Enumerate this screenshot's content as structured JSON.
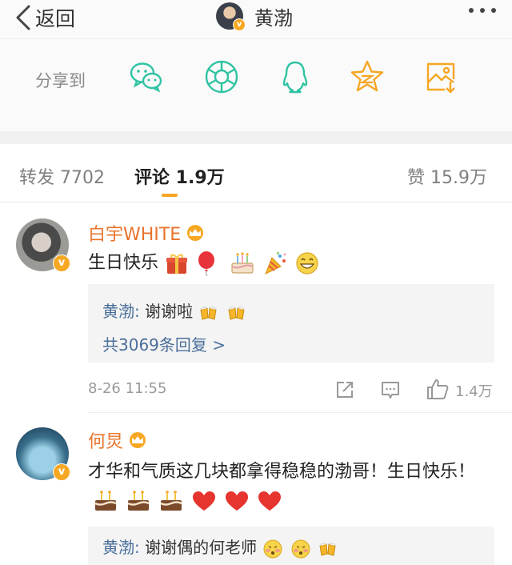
{
  "nav": {
    "back_label": "返回",
    "title": "黄渤"
  },
  "share": {
    "label": "分享到",
    "icons": [
      "wechat-icon",
      "moments-icon",
      "qq-icon",
      "qzone-icon",
      "save-image-icon"
    ]
  },
  "tabs": {
    "repost": "转发 7702",
    "comment": "评论 1.9万",
    "like": "赞 15.9万"
  },
  "comments": [
    {
      "username": "白宇WHITE",
      "text": "生日快乐",
      "emojis": [
        "gift",
        "balloon",
        "cake",
        "party-popper",
        "grin"
      ],
      "reply": {
        "name": "黄渤:",
        "text": "谢谢啦",
        "emojis": [
          "cheers",
          "cheers"
        ]
      },
      "reply_more": "共3069条回复 >",
      "time": "8-26 11:55",
      "likes": "1.4万"
    },
    {
      "username": "何炅",
      "text": "才华和气质这几块都拿得稳稳的渤哥！生日快乐！",
      "emojis": [
        "cake",
        "cake",
        "cake",
        "heart",
        "heart",
        "heart"
      ],
      "reply": {
        "name": "黄渤:",
        "text": "谢谢偶的何老师",
        "emojis": [
          "blush",
          "blush",
          "cheers"
        ]
      }
    }
  ],
  "colors": {
    "accent": "#f5a623",
    "username": "#e8742c",
    "reply_link": "#4a6e9a",
    "share_icon": "#2fc3a2"
  }
}
